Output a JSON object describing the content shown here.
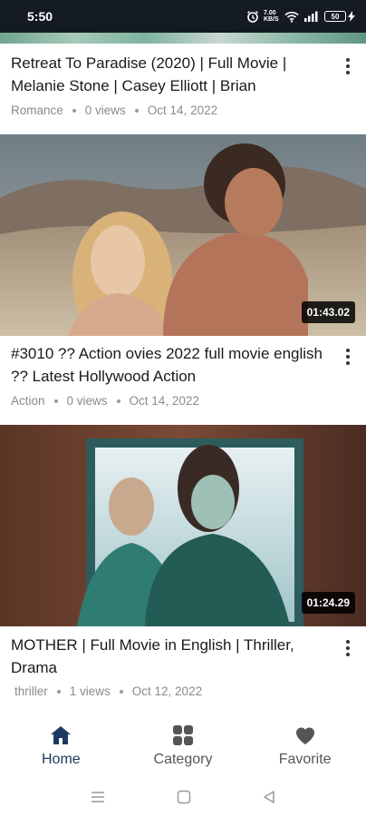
{
  "status_bar": {
    "time": "5:50",
    "net_speed": "7.00\nKB/S",
    "battery": "50"
  },
  "videos": [
    {
      "title": "Retreat To Paradise (2020) | Full Movie | Melanie Stone | Casey Elliott | Brian",
      "category": "Romance",
      "views": "0 views",
      "date": "Oct 14, 2022"
    },
    {
      "title": "#3010 ?? Action ovies 2022 full movie english ?? Latest Hollywood Action",
      "category": "Action",
      "views": "0 views",
      "date": "Oct 14, 2022",
      "duration": "01:43.02"
    },
    {
      "title": "MOTHER | Full Movie in English | Thriller, Drama",
      "category": "thriller",
      "views": "1 views",
      "date": "Oct 12, 2022",
      "duration": "01:24.29"
    }
  ],
  "bottom_nav": {
    "items": [
      {
        "label": "Home",
        "icon": "home-icon",
        "active": true
      },
      {
        "label": "Category",
        "icon": "grid-icon",
        "active": false
      },
      {
        "label": "Favorite",
        "icon": "heart-icon",
        "active": false
      }
    ]
  },
  "colors": {
    "active_nav": "#1d3a63",
    "inactive_nav": "#555555",
    "status_bar_bg": "#141a24"
  }
}
